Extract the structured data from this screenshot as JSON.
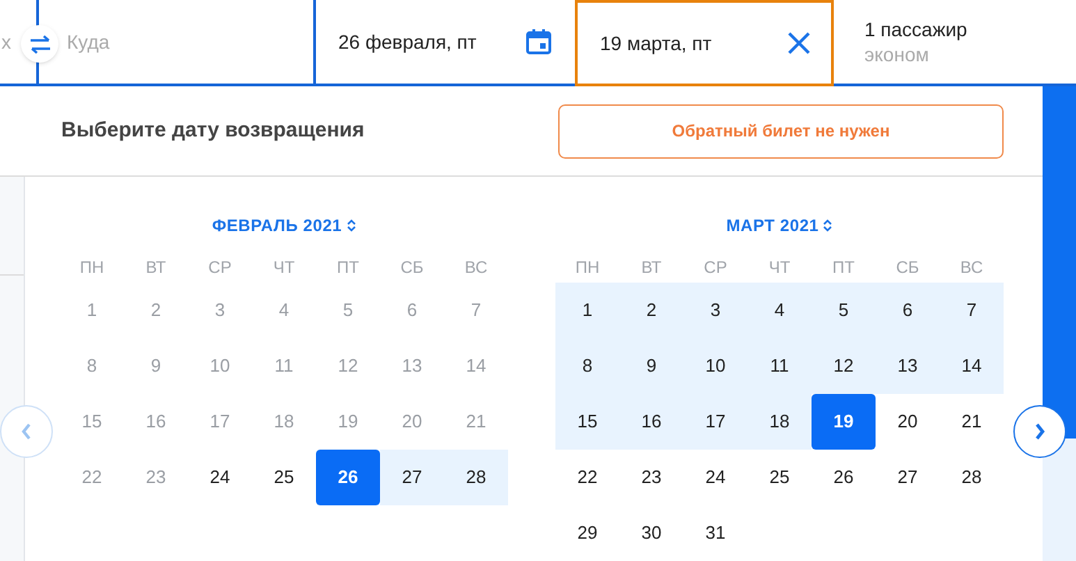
{
  "search": {
    "origin_partial": "х",
    "destination": {
      "placeholder": "Куда"
    },
    "depart_date": "26 февраля, пт",
    "return_date": {
      "value": "19 марта, пт",
      "focused": true
    },
    "passengers": "1 пассажир",
    "cabin": "эконом"
  },
  "header": {
    "title": "Выберите дату возвращения",
    "no_return_button": "Обратный билет не нужен"
  },
  "months": [
    {
      "title": "ФЕВРАЛЬ 2021",
      "weekdays": [
        "ПН",
        "ВТ",
        "СР",
        "ЧТ",
        "ПТ",
        "СБ",
        "ВС"
      ],
      "days": [
        {
          "day": "1",
          "disabled": true,
          "in_range": false,
          "selected": false
        },
        {
          "day": "2",
          "disabled": true,
          "in_range": false,
          "selected": false
        },
        {
          "day": "3",
          "disabled": true,
          "in_range": false,
          "selected": false
        },
        {
          "day": "4",
          "disabled": true,
          "in_range": false,
          "selected": false
        },
        {
          "day": "5",
          "disabled": true,
          "in_range": false,
          "selected": false
        },
        {
          "day": "6",
          "disabled": true,
          "in_range": false,
          "selected": false
        },
        {
          "day": "7",
          "disabled": true,
          "in_range": false,
          "selected": false
        },
        {
          "day": "8",
          "disabled": true,
          "in_range": false,
          "selected": false
        },
        {
          "day": "9",
          "disabled": true,
          "in_range": false,
          "selected": false
        },
        {
          "day": "10",
          "disabled": true,
          "in_range": false,
          "selected": false
        },
        {
          "day": "11",
          "disabled": true,
          "in_range": false,
          "selected": false
        },
        {
          "day": "12",
          "disabled": true,
          "in_range": false,
          "selected": false
        },
        {
          "day": "13",
          "disabled": true,
          "in_range": false,
          "selected": false
        },
        {
          "day": "14",
          "disabled": true,
          "in_range": false,
          "selected": false
        },
        {
          "day": "15",
          "disabled": true,
          "in_range": false,
          "selected": false
        },
        {
          "day": "16",
          "disabled": true,
          "in_range": false,
          "selected": false
        },
        {
          "day": "17",
          "disabled": true,
          "in_range": false,
          "selected": false
        },
        {
          "day": "18",
          "disabled": true,
          "in_range": false,
          "selected": false
        },
        {
          "day": "19",
          "disabled": true,
          "in_range": false,
          "selected": false
        },
        {
          "day": "20",
          "disabled": true,
          "in_range": false,
          "selected": false
        },
        {
          "day": "21",
          "disabled": true,
          "in_range": false,
          "selected": false
        },
        {
          "day": "22",
          "disabled": true,
          "in_range": false,
          "selected": false
        },
        {
          "day": "23",
          "disabled": true,
          "in_range": false,
          "selected": false
        },
        {
          "day": "24",
          "disabled": false,
          "in_range": false,
          "selected": false
        },
        {
          "day": "25",
          "disabled": false,
          "in_range": false,
          "selected": false
        },
        {
          "day": "26",
          "disabled": false,
          "in_range": false,
          "selected": true
        },
        {
          "day": "27",
          "disabled": false,
          "in_range": true,
          "selected": false
        },
        {
          "day": "28",
          "disabled": false,
          "in_range": true,
          "selected": false
        }
      ]
    },
    {
      "title": "МАРТ 2021",
      "weekdays": [
        "ПН",
        "ВТ",
        "СР",
        "ЧТ",
        "ПТ",
        "СБ",
        "ВС"
      ],
      "days": [
        {
          "day": "1",
          "disabled": false,
          "in_range": true,
          "selected": false
        },
        {
          "day": "2",
          "disabled": false,
          "in_range": true,
          "selected": false
        },
        {
          "day": "3",
          "disabled": false,
          "in_range": true,
          "selected": false
        },
        {
          "day": "4",
          "disabled": false,
          "in_range": true,
          "selected": false
        },
        {
          "day": "5",
          "disabled": false,
          "in_range": true,
          "selected": false
        },
        {
          "day": "6",
          "disabled": false,
          "in_range": true,
          "selected": false
        },
        {
          "day": "7",
          "disabled": false,
          "in_range": true,
          "selected": false
        },
        {
          "day": "8",
          "disabled": false,
          "in_range": true,
          "selected": false
        },
        {
          "day": "9",
          "disabled": false,
          "in_range": true,
          "selected": false
        },
        {
          "day": "10",
          "disabled": false,
          "in_range": true,
          "selected": false
        },
        {
          "day": "11",
          "disabled": false,
          "in_range": true,
          "selected": false
        },
        {
          "day": "12",
          "disabled": false,
          "in_range": true,
          "selected": false
        },
        {
          "day": "13",
          "disabled": false,
          "in_range": true,
          "selected": false
        },
        {
          "day": "14",
          "disabled": false,
          "in_range": true,
          "selected": false
        },
        {
          "day": "15",
          "disabled": false,
          "in_range": true,
          "selected": false
        },
        {
          "day": "16",
          "disabled": false,
          "in_range": true,
          "selected": false
        },
        {
          "day": "17",
          "disabled": false,
          "in_range": true,
          "selected": false
        },
        {
          "day": "18",
          "disabled": false,
          "in_range": true,
          "selected": false
        },
        {
          "day": "19",
          "disabled": false,
          "in_range": false,
          "selected": true
        },
        {
          "day": "20",
          "disabled": false,
          "in_range": false,
          "selected": false
        },
        {
          "day": "21",
          "disabled": false,
          "in_range": false,
          "selected": false
        },
        {
          "day": "22",
          "disabled": false,
          "in_range": false,
          "selected": false
        },
        {
          "day": "23",
          "disabled": false,
          "in_range": false,
          "selected": false
        },
        {
          "day": "24",
          "disabled": false,
          "in_range": false,
          "selected": false
        },
        {
          "day": "25",
          "disabled": false,
          "in_range": false,
          "selected": false
        },
        {
          "day": "26",
          "disabled": false,
          "in_range": false,
          "selected": false
        },
        {
          "day": "27",
          "disabled": false,
          "in_range": false,
          "selected": false
        },
        {
          "day": "28",
          "disabled": false,
          "in_range": false,
          "selected": false
        },
        {
          "day": "29",
          "disabled": false,
          "in_range": false,
          "selected": false
        },
        {
          "day": "30",
          "disabled": false,
          "in_range": false,
          "selected": false
        },
        {
          "day": "31",
          "disabled": false,
          "in_range": false,
          "selected": false
        }
      ]
    }
  ]
}
